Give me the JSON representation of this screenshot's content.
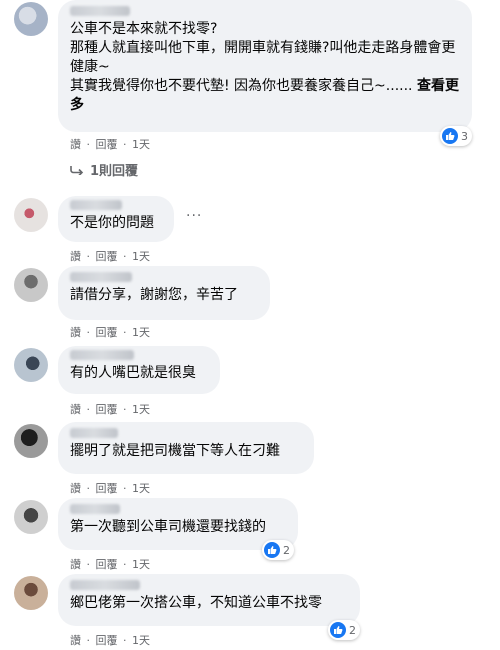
{
  "comments": [
    {
      "text": "公車不是本來就不找零?\n那種人就直接叫他下車，開開車就有錢賺?叫他走走路身體會更健康~\n其實我覺得你也不要代墊! 因為你也要養家養自己~......",
      "see_more": "查看更多",
      "like": "讚",
      "reply": "回覆",
      "time": "1天",
      "reactions": "3",
      "replies_link": "1則回覆"
    },
    {
      "text": "不是你的問題",
      "like": "讚",
      "reply": "回覆",
      "time": "1天"
    },
    {
      "text": "請借分享，謝謝您，辛苦了",
      "like": "讚",
      "reply": "回覆",
      "time": "1天"
    },
    {
      "text": "有的人嘴巴就是很臭",
      "like": "讚",
      "reply": "回覆",
      "time": "1天"
    },
    {
      "text": "擺明了就是把司機當下等人在刁難",
      "like": "讚",
      "reply": "回覆",
      "time": "1天"
    },
    {
      "text": "第一次聽到公車司機還要找錢的",
      "like": "讚",
      "reply": "回覆",
      "time": "1天",
      "reactions": "2"
    },
    {
      "text": "鄉巴佬第一次搭公車，不知道公車不找零",
      "like": "讚",
      "reply": "回覆",
      "time": "1天",
      "reactions": "2"
    }
  ],
  "separator": "·",
  "more_options": "···",
  "colors": {
    "like_blue": "#1877f2",
    "bubble": "#f0f2f5",
    "meta": "#65676b"
  }
}
